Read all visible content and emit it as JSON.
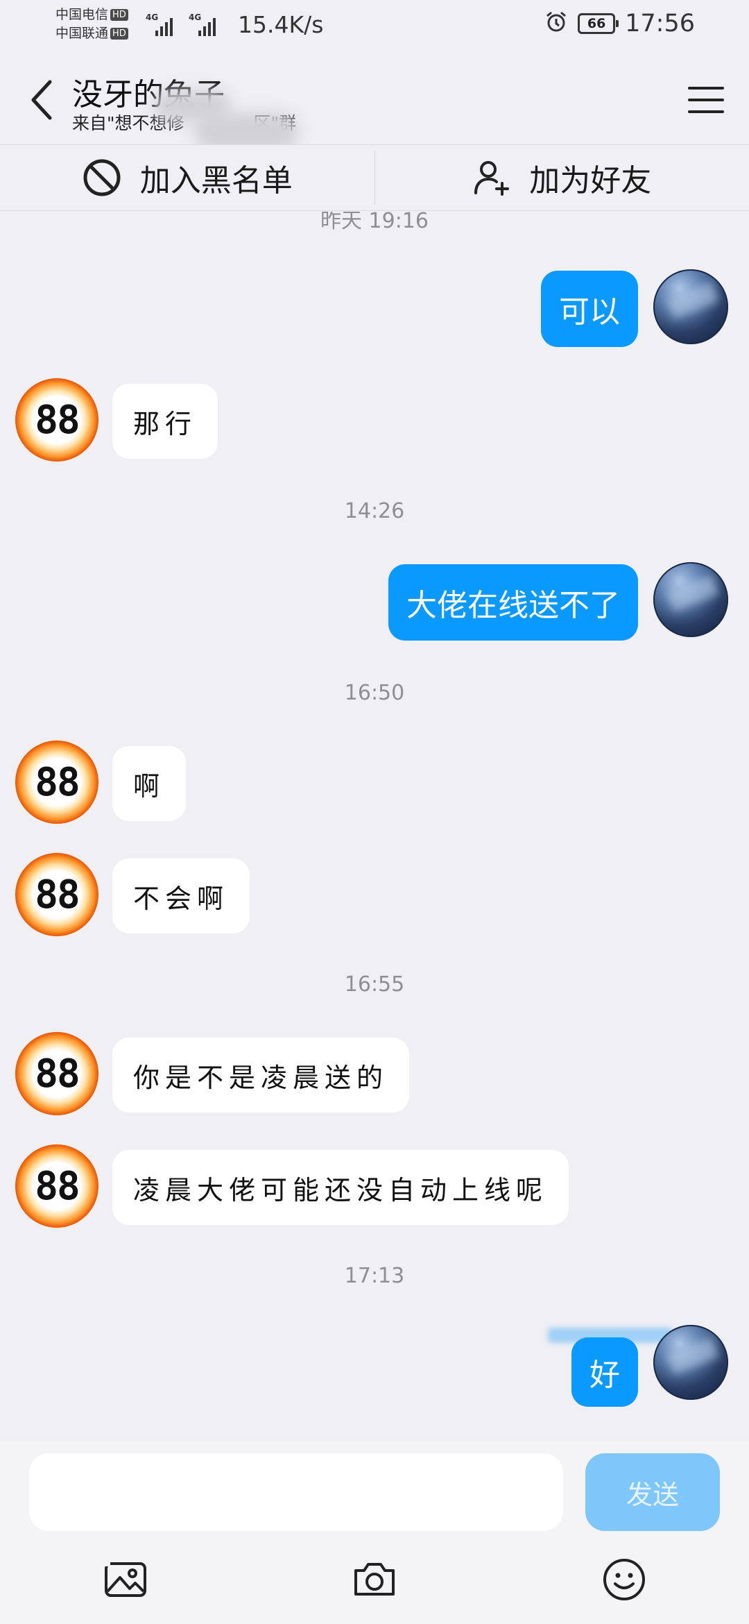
{
  "status_bar": {
    "carrier_1": "中国电信",
    "carrier_2": "中国联通",
    "hd_badge": "HD",
    "network_type": "4G",
    "net_speed": "15.4K/s",
    "battery_level": "66",
    "time": "17:56"
  },
  "header": {
    "title": "没牙的兔子",
    "subtitle": "来自\"想不想修　　　　区\"群"
  },
  "actions": {
    "blacklist_label": "加入黑名单",
    "add_friend_label": "加为好友"
  },
  "chat": {
    "avatar_other_text": "88",
    "time_labels": [
      "昨天 19:16",
      "14:26",
      "16:50",
      "16:55",
      "17:13"
    ],
    "messages": [
      {
        "from": "me",
        "text": "可以"
      },
      {
        "from": "other",
        "text": "那行"
      },
      {
        "from": "me",
        "text": "大佬在线送不了"
      },
      {
        "from": "other",
        "text": "啊"
      },
      {
        "from": "other",
        "text": "不会啊"
      },
      {
        "from": "other",
        "text": "你是不是凌晨送的"
      },
      {
        "from": "other",
        "text": "凌晨大佬可能还没自动上线呢"
      },
      {
        "from": "me",
        "text": "好"
      }
    ]
  },
  "input": {
    "placeholder": "",
    "value": "",
    "send_label": "发送"
  },
  "colors": {
    "outgoing_bubble": "#0a99ff",
    "incoming_bubble": "#ffffff",
    "background": "#efeff4",
    "send_disabled": "#7fc7fa"
  }
}
